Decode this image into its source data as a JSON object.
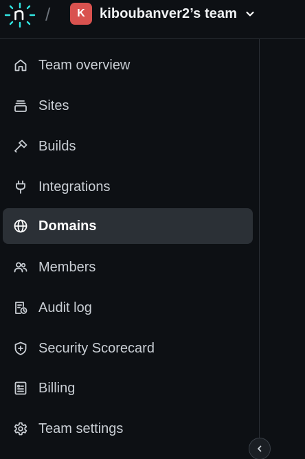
{
  "header": {
    "team_initial": "K",
    "team_name": "kiboubanver2’s team",
    "separator": "/"
  },
  "colors": {
    "background": "#0d1014",
    "logo_teal": "#32e6e2",
    "avatar": "#d9524f",
    "active_item": "#2b3036"
  },
  "sidebar": {
    "items": [
      {
        "label": "Team overview",
        "icon": "home-icon",
        "active": false
      },
      {
        "label": "Sites",
        "icon": "layers-icon",
        "active": false
      },
      {
        "label": "Builds",
        "icon": "hammer-icon",
        "active": false
      },
      {
        "label": "Integrations",
        "icon": "plug-icon",
        "active": false
      },
      {
        "label": "Domains",
        "icon": "globe-icon",
        "active": true
      },
      {
        "label": "Members",
        "icon": "users-icon",
        "active": false
      },
      {
        "label": "Audit log",
        "icon": "audit-log-icon",
        "active": false
      },
      {
        "label": "Security Scorecard",
        "icon": "shield-icon",
        "active": false
      },
      {
        "label": "Billing",
        "icon": "receipt-icon",
        "active": false
      },
      {
        "label": "Team settings",
        "icon": "gear-icon",
        "active": false
      }
    ]
  },
  "collapse_button": {
    "icon": "chevron-left-icon"
  }
}
